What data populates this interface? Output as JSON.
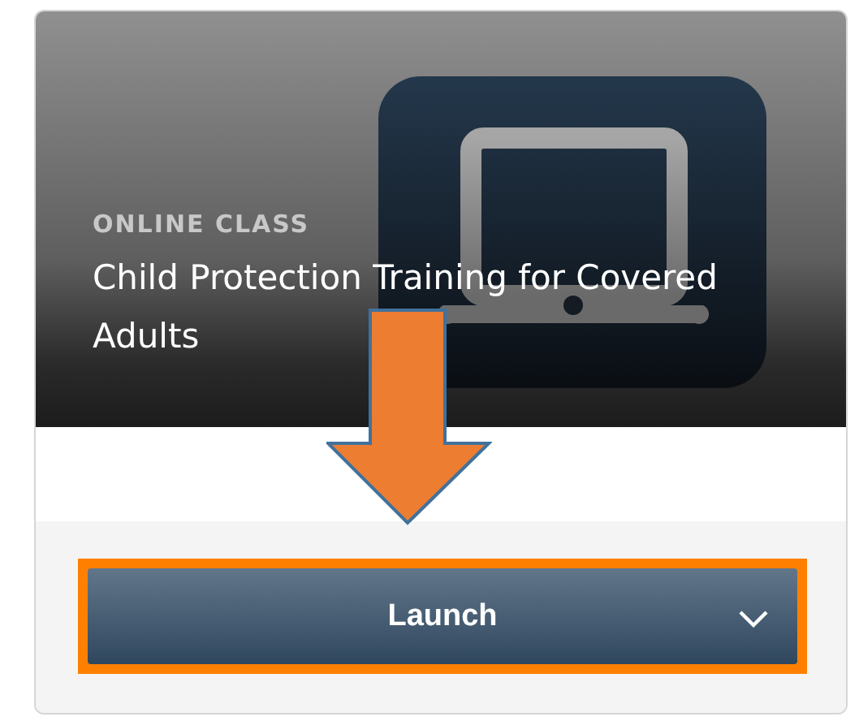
{
  "card": {
    "category": "ONLINE CLASS",
    "title": "Child Protection Training for Covered Adults"
  },
  "launch_button": {
    "label": "Launch",
    "highlighted": true
  }
}
